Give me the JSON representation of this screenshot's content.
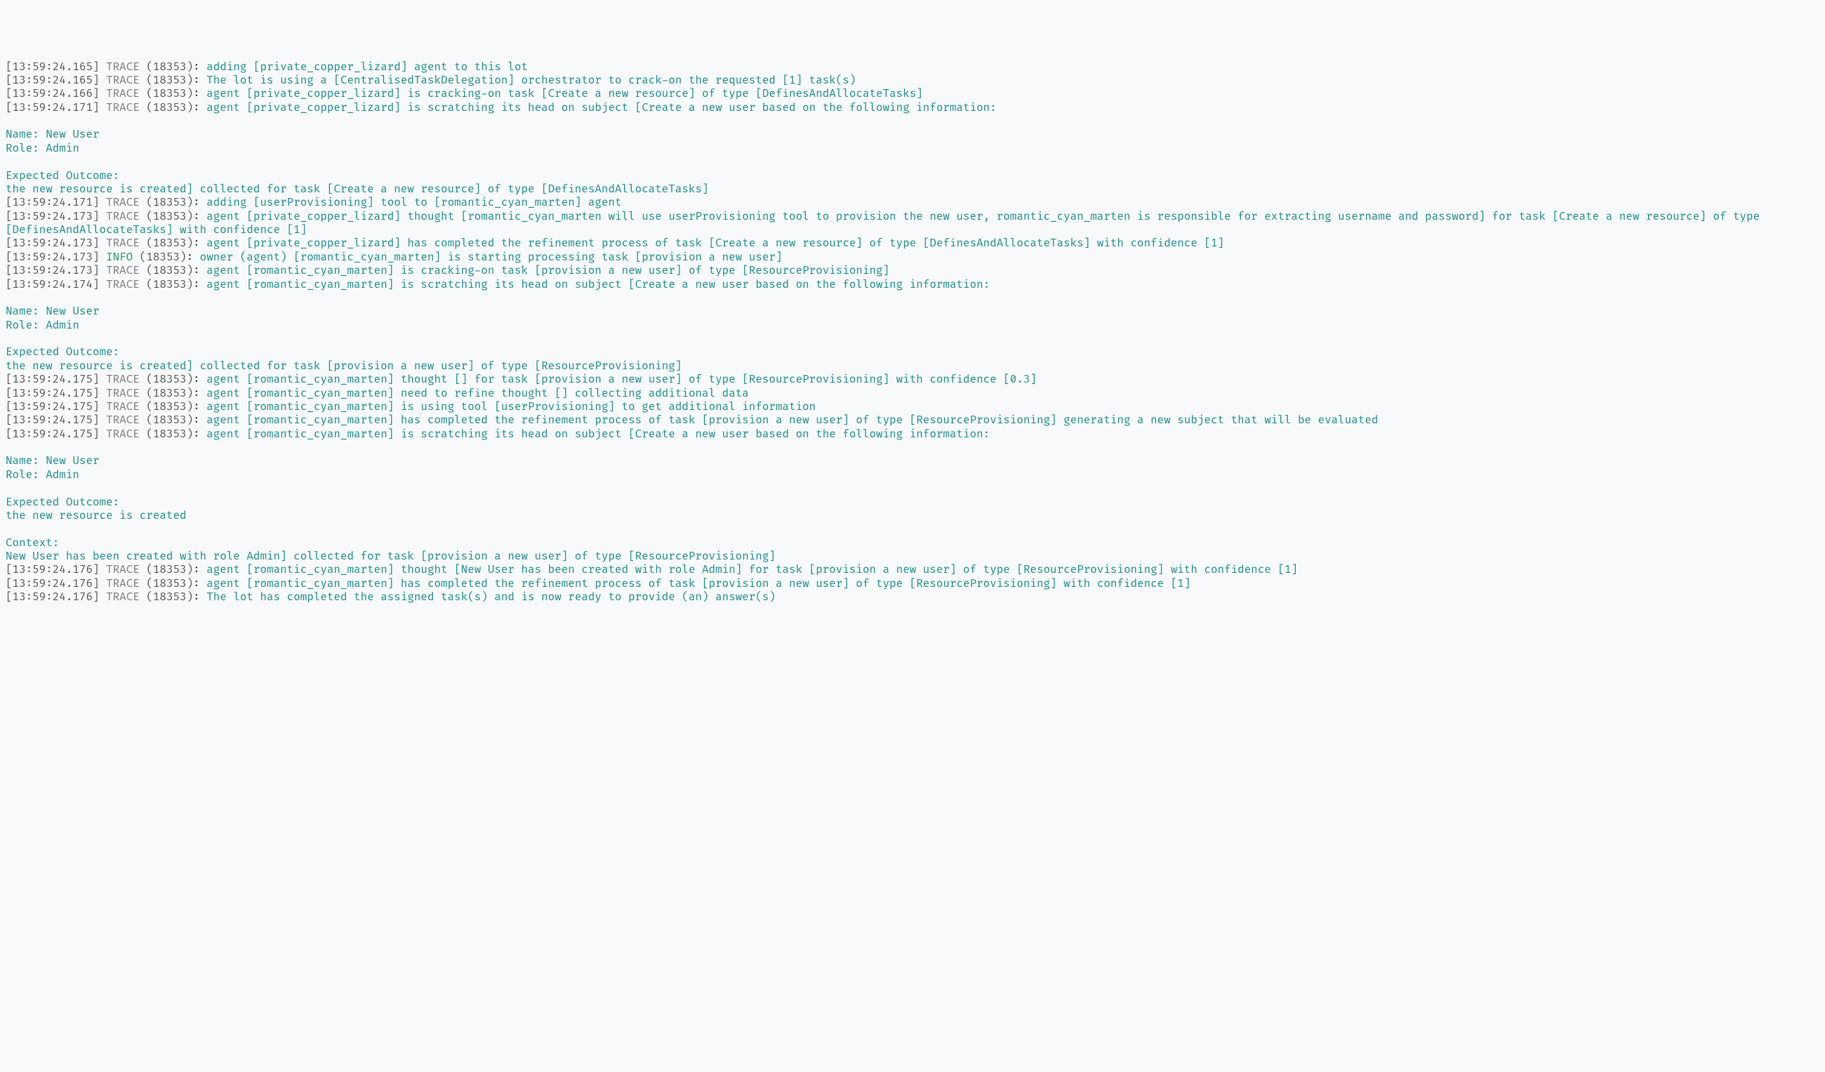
{
  "pid": "(18353)",
  "levels": {
    "TRACE": "TRACE",
    "INFO": "INFO"
  },
  "lines": [
    {
      "ts": "[13:59:24.165]",
      "lvl": "TRACE",
      "msg": "adding [private_copper_lizard] agent to this lot"
    },
    {
      "ts": "[13:59:24.165]",
      "lvl": "TRACE",
      "msg": "The lot is using a [CentralisedTaskDelegation] orchestrator to crack-on the requested [1] task(s)"
    },
    {
      "ts": "[13:59:24.166]",
      "lvl": "TRACE",
      "msg": "agent [private_copper_lizard] is cracking-on task [Create a new resource] of type [DefinesAndAllocateTasks]"
    },
    {
      "ts": "[13:59:24.171]",
      "lvl": "TRACE",
      "msg": "agent [private_copper_lizard] is scratching its head on subject [Create a new user based on the following information:\n\nName: New User\nRole: Admin\n\nExpected Outcome:\nthe new resource is created] collected for task [Create a new resource] of type [DefinesAndAllocateTasks]"
    },
    {
      "ts": "[13:59:24.171]",
      "lvl": "TRACE",
      "msg": "adding [userProvisioning] tool to [romantic_cyan_marten] agent"
    },
    {
      "ts": "[13:59:24.173]",
      "lvl": "TRACE",
      "msg": "agent [private_copper_lizard] thought [romantic_cyan_marten will use userProvisioning tool to provision the new user, romantic_cyan_marten is responsible for extracting username and password] for task [Create a new resource] of type [DefinesAndAllocateTasks] with confidence [1]"
    },
    {
      "ts": "[13:59:24.173]",
      "lvl": "TRACE",
      "msg": "agent [private_copper_lizard] has completed the refinement process of task [Create a new resource] of type [DefinesAndAllocateTasks] with confidence [1]"
    },
    {
      "ts": "[13:59:24.173]",
      "lvl": "INFO",
      "msg": "owner (agent) [romantic_cyan_marten] is starting processing task [provision a new user]"
    },
    {
      "ts": "[13:59:24.173]",
      "lvl": "TRACE",
      "msg": "agent [romantic_cyan_marten] is cracking-on task [provision a new user] of type [ResourceProvisioning]"
    },
    {
      "ts": "[13:59:24.174]",
      "lvl": "TRACE",
      "msg": "agent [romantic_cyan_marten] is scratching its head on subject [Create a new user based on the following information:\n\nName: New User\nRole: Admin\n\nExpected Outcome:\nthe new resource is created] collected for task [provision a new user] of type [ResourceProvisioning]"
    },
    {
      "ts": "[13:59:24.175]",
      "lvl": "TRACE",
      "msg": "agent [romantic_cyan_marten] thought [] for task [provision a new user] of type [ResourceProvisioning] with confidence [0.3]"
    },
    {
      "ts": "[13:59:24.175]",
      "lvl": "TRACE",
      "msg": "agent [romantic_cyan_marten] need to refine thought [] collecting additional data"
    },
    {
      "ts": "[13:59:24.175]",
      "lvl": "TRACE",
      "msg": "agent [romantic_cyan_marten] is using tool [userProvisioning] to get additional information"
    },
    {
      "ts": "[13:59:24.175]",
      "lvl": "TRACE",
      "msg": "agent [romantic_cyan_marten] has completed the refinement process of task [provision a new user] of type [ResourceProvisioning] generating a new subject that will be evaluated"
    },
    {
      "ts": "[13:59:24.175]",
      "lvl": "TRACE",
      "msg": "agent [romantic_cyan_marten] is scratching its head on subject [Create a new user based on the following information:\n\nName: New User\nRole: Admin\n\nExpected Outcome:\nthe new resource is created\n\nContext:\nNew User has been created with role Admin] collected for task [provision a new user] of type [ResourceProvisioning]"
    },
    {
      "ts": "[13:59:24.176]",
      "lvl": "TRACE",
      "msg": "agent [romantic_cyan_marten] thought [New User has been created with role Admin] for task [provision a new user] of type [ResourceProvisioning] with confidence [1]"
    },
    {
      "ts": "[13:59:24.176]",
      "lvl": "TRACE",
      "msg": "agent [romantic_cyan_marten] has completed the refinement process of task [provision a new user] of type [ResourceProvisioning] with confidence [1]"
    },
    {
      "ts": "[13:59:24.176]",
      "lvl": "TRACE",
      "msg": "The lot has completed the assigned task(s) and is now ready to provide (an) answer(s)"
    }
  ]
}
